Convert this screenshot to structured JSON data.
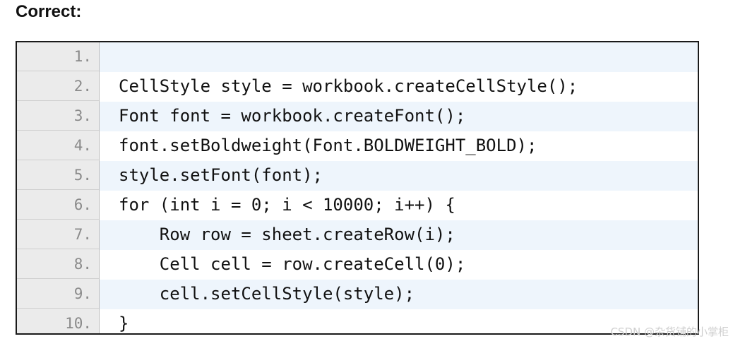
{
  "heading": "Correct:",
  "code_lines": [
    {
      "number": "1.",
      "text": ""
    },
    {
      "number": "2.",
      "text": "CellStyle style = workbook.createCellStyle();"
    },
    {
      "number": "3.",
      "text": "Font font = workbook.createFont();"
    },
    {
      "number": "4.",
      "text": "font.setBoldweight(Font.BOLDWEIGHT_BOLD);"
    },
    {
      "number": "5.",
      "text": "style.setFont(font);"
    },
    {
      "number": "6.",
      "text": "for (int i = 0; i < 10000; i++) {"
    },
    {
      "number": "7.",
      "text": "    Row row = sheet.createRow(i);"
    },
    {
      "number": "8.",
      "text": "    Cell cell = row.createCell(0);"
    },
    {
      "number": "9.",
      "text": "    cell.setCellStyle(style);"
    },
    {
      "number": "10.",
      "text": "}"
    }
  ],
  "watermark": "CSDN @杂货铺的小掌柜",
  "colors": {
    "gutter_background": "#ebebeb",
    "stripe_background": "#eef5fc",
    "line_number_color": "#8a8a8a"
  }
}
